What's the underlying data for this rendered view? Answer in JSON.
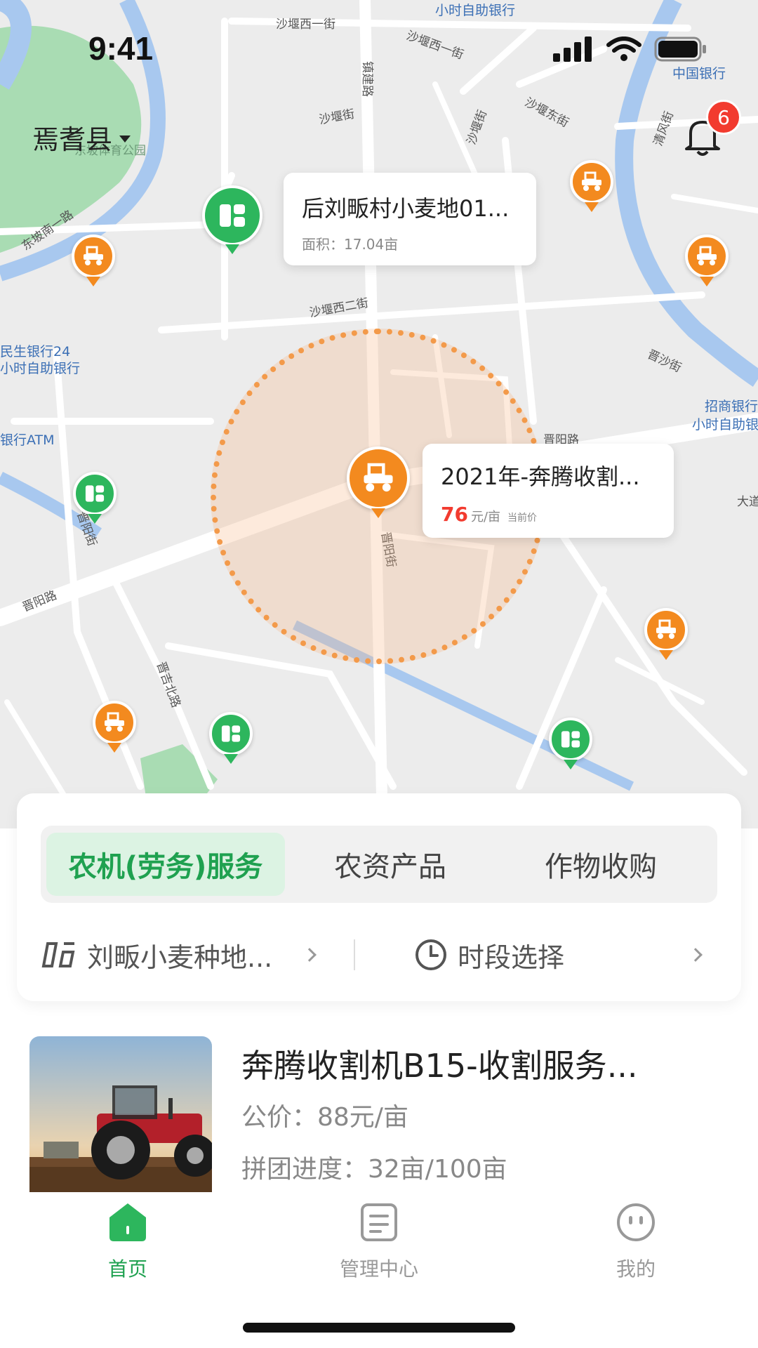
{
  "status_bar": {
    "time": "9:41"
  },
  "header": {
    "county": "焉耆县",
    "notification_count": "6"
  },
  "map": {
    "labels": {
      "road_1": "沙堰西一街",
      "road_2": "沙堰西一街",
      "bank_top": "小时自助银行",
      "boc": "中国银行",
      "road_3": "沙堰街",
      "road_4": "沙堰东街",
      "road_5": "沙堰街",
      "road_6": "清风街",
      "road_7": "镇建路",
      "park": "东坡体育公园",
      "road_8": "东坡南一路",
      "road_9": "沙堰西二街",
      "road_10": "晋沙街",
      "bank_left_1": "民生银行24",
      "bank_left_2": "小时自助银行",
      "atm_left": "银行ATM",
      "cmb_1": "招商银行",
      "cmb_2": "小时自助银",
      "road_11": "晋阳路",
      "road_12": "晋阳街",
      "road_13": "晋阳路",
      "road_14": "晋吉北路",
      "road_15": "晋阳街",
      "right_edge": "大道"
    },
    "callout_field": {
      "title": "后刘畈村小麦地01...",
      "subtitle": "面积：17.04亩"
    },
    "callout_machine": {
      "title": "2021年-奔腾收割...",
      "price": "76",
      "unit": "元/亩",
      "note": "当前价"
    },
    "colors": {
      "orange_pin": "#f38a1f",
      "green_pin": "#2db65d",
      "water": "#a8c8ef",
      "park": "#a9dcb3"
    }
  },
  "tabs": [
    {
      "label": "农机(劳务)服务",
      "active": true
    },
    {
      "label": "农资产品",
      "active": false
    },
    {
      "label": "作物收购",
      "active": false
    }
  ],
  "filters": {
    "field": "刘畈小麦种地...",
    "time": "时段选择"
  },
  "list": [
    {
      "title": "奔腾收割机B15-收割服务...",
      "price": "公价：88元/亩",
      "progress": "拼团进度：32亩/100亩"
    }
  ],
  "nav": [
    {
      "label": "首页",
      "icon": "home-icon",
      "active": true
    },
    {
      "label": "管理中心",
      "icon": "document-icon",
      "active": false
    },
    {
      "label": "我的",
      "icon": "face-icon",
      "active": false
    }
  ],
  "accent_color": "#1fa150"
}
